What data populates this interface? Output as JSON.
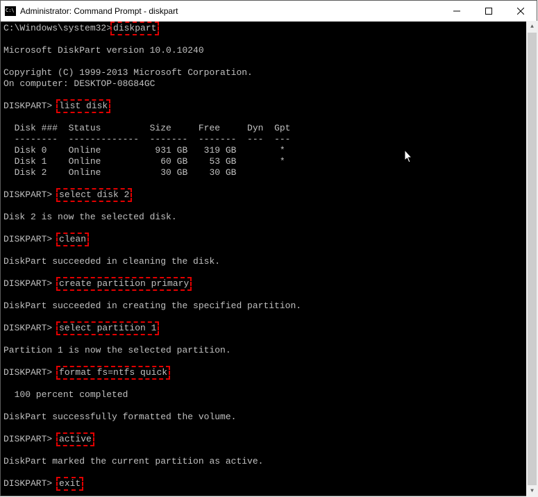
{
  "window": {
    "title": "Administrator: Command Prompt - diskpart"
  },
  "prompts": {
    "path": "C:\\Windows\\system32>",
    "diskpart": "DISKPART> "
  },
  "commands": {
    "diskpart": "diskpart",
    "list_disk": "list disk",
    "select_disk": "select disk 2",
    "clean": "clean",
    "create_partition": "create partition primary",
    "select_partition": "select partition 1",
    "format": "format fs=ntfs quick",
    "active": "active",
    "exit": "exit"
  },
  "output": {
    "version": "Microsoft DiskPart version 10.0.10240",
    "copyright": "Copyright (C) 1999-2013 Microsoft Corporation.",
    "computer": "On computer: DESKTOP-08G84GC",
    "table_header": "  Disk ###  Status         Size     Free     Dyn  Gpt",
    "table_divider": "  --------  -------------  -------  -------  ---  ---",
    "disks": [
      "  Disk 0    Online          931 GB   319 GB        *",
      "  Disk 1    Online           60 GB    53 GB        *",
      "  Disk 2    Online           30 GB    30 GB"
    ],
    "selected_disk": "Disk 2 is now the selected disk.",
    "clean_ok": "DiskPart succeeded in cleaning the disk.",
    "create_ok": "DiskPart succeeded in creating the specified partition.",
    "selected_part": "Partition 1 is now the selected partition.",
    "format_progress": "  100 percent completed",
    "format_ok": "DiskPart successfully formatted the volume.",
    "active_ok": "DiskPart marked the current partition as active."
  }
}
